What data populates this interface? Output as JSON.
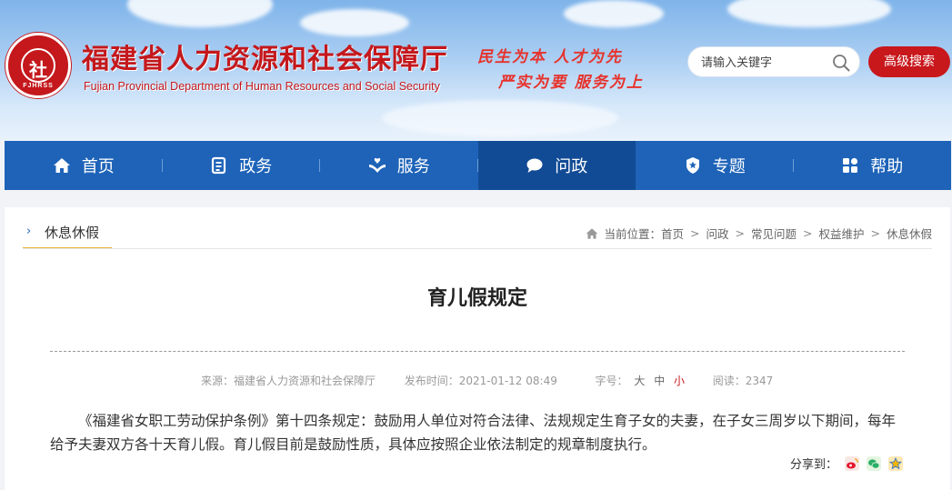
{
  "header": {
    "logo_abbr": "FJHRSS",
    "logo_glyph": "社",
    "title": "福建省人力资源和社会保障厅",
    "subtitle": "Fujian Provincial Department of Human Resources and Social Security",
    "slogan_line1": "民生为本  人才为先",
    "slogan_line2": "严实为要  服务为上",
    "search_placeholder": "请输入关键字",
    "advanced_search_label": "高级搜索"
  },
  "nav": {
    "items": [
      {
        "label": "首页",
        "icon": "home-icon"
      },
      {
        "label": "政务",
        "icon": "document-icon"
      },
      {
        "label": "服务",
        "icon": "hands-icon"
      },
      {
        "label": "问政",
        "icon": "chat-icon"
      },
      {
        "label": "专题",
        "icon": "badge-icon"
      },
      {
        "label": "帮助",
        "icon": "grid-icon"
      }
    ],
    "active_index": 3
  },
  "section": {
    "tab_label": "休息休假",
    "breadcrumb_prefix": "当前位置：",
    "breadcrumb": [
      "首页",
      "问政",
      "常见问题",
      "权益维护",
      "休息休假"
    ]
  },
  "article": {
    "title": "育儿假规定",
    "source_label": "来源：",
    "source": "福建省人力资源和社会保障厅",
    "time_label": "发布时间：",
    "time": "2021-01-12 08:49",
    "font_label": "字号：",
    "font_sizes": [
      "大",
      "中",
      "小"
    ],
    "views_label": "阅读：",
    "views": "2347",
    "body": "《福建省女职工劳动保护条例》第十四条规定：鼓励用人单位对符合法律、法规规定生育子女的夫妻，在子女三周岁以下期间，每年给予夫妻双方各十天育儿假。育儿假目前是鼓励性质，具体应按照企业依法制定的规章制度执行。",
    "share_label": "分享到："
  },
  "colors": {
    "brand_red": "#c8181c",
    "nav_blue": "#1e63b8",
    "nav_active": "#124b95",
    "tab_underline": "#e8b43a"
  }
}
